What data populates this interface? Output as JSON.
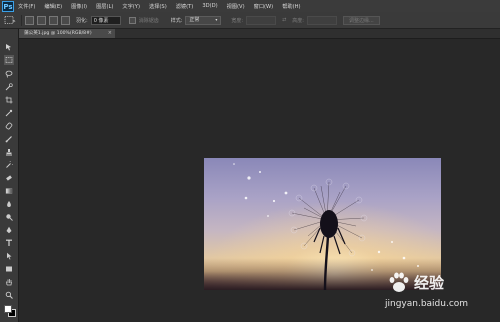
{
  "app": {
    "logo": "Ps"
  },
  "menu": [
    "文件(F)",
    "编辑(E)",
    "图像(I)",
    "图层(L)",
    "文字(Y)",
    "选择(S)",
    "滤镜(T)",
    "3D(D)",
    "视图(V)",
    "窗口(W)",
    "帮助(H)"
  ],
  "options": {
    "feather_label": "羽化:",
    "feather_value": "0 像素",
    "antialias_label": "消除锯齿",
    "style_label": "样式:",
    "style_value": "正常",
    "width_label": "宽度:",
    "height_label": "高度:",
    "refine_edge": "调整边缘..."
  },
  "document": {
    "tab_title": "蒲公英1.jpg @ 100%(RGB/8#)",
    "close": "×"
  },
  "watermark": {
    "brand": "经验",
    "url": "jingyan.baidu.com"
  },
  "colors": {
    "accent": "#3aa0e8",
    "panel": "#3a3a3a",
    "workspace": "#282828"
  }
}
